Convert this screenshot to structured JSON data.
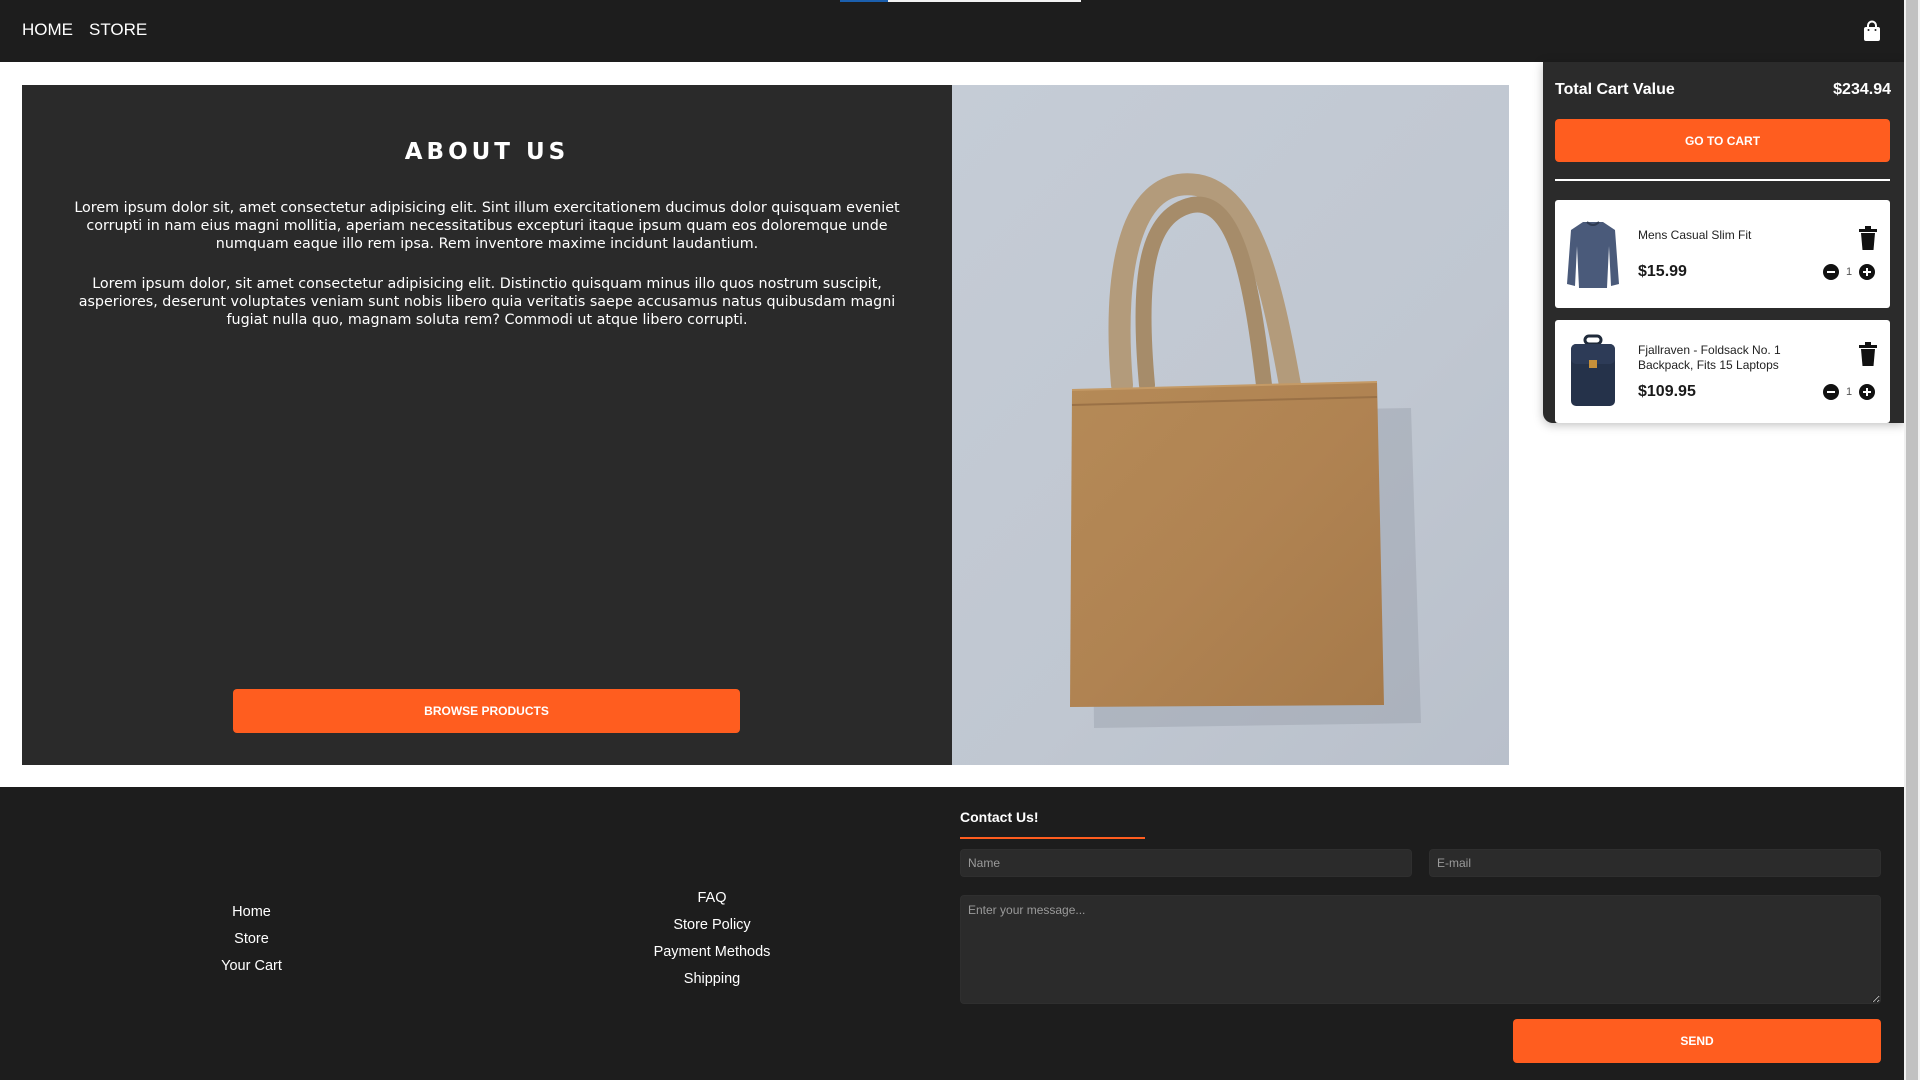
{
  "nav": {
    "home": "HOME",
    "store": "STORE",
    "bag_icon": "shopping-bag-icon",
    "progress": 0.2
  },
  "about": {
    "title": "ABOUT US",
    "paragraph1": "Lorem ipsum dolor sit, amet consectetur adipisicing elit. Sint illum exercitationem ducimus dolor quisquam eveniet corrupti in nam eius magni mollitia, aperiam necessitatibus excepturi itaque ipsum quam eos doloremque unde numquam eaque illo rem ipsa. Rem inventore maxime incidunt laudantium.",
    "paragraph2": "Lorem ipsum dolor, sit amet consectetur adipisicing elit. Distinctio quisquam minus illo quos nostrum suscipit, asperiores, deserunt voluptates veniam sunt nobis libero quia veritatis saepe accusamus natus quibusdam magni fugiat nulla quo, magnam soluta rem? Commodi ut atque libero corrupti.",
    "browse_label": "BROWSE PRODUCTS"
  },
  "cart": {
    "total_label": "Total Cart Value",
    "total_value": "$234.94",
    "goto_label": "GO TO CART",
    "items": [
      {
        "name": "Mens Casual Slim Fit",
        "price": "$15.99",
        "qty": "1"
      },
      {
        "name": "Fjallraven - Foldsack No. 1 Backpack, Fits 15 Laptops",
        "price": "$109.95",
        "qty": "1"
      }
    ]
  },
  "footer": {
    "col1": [
      "Home",
      "Store",
      "Your Cart"
    ],
    "col2": [
      "FAQ",
      "Store Policy",
      "Payment Methods",
      "Shipping"
    ],
    "contact_title": "Contact Us!",
    "name_placeholder": "Name",
    "email_placeholder": "E-mail",
    "message_placeholder": "Enter your message...",
    "send_label": "SEND"
  },
  "colors": {
    "accent": "#ff5d1f",
    "dark": "#1d1d1d",
    "panel": "#2a2a2a"
  }
}
